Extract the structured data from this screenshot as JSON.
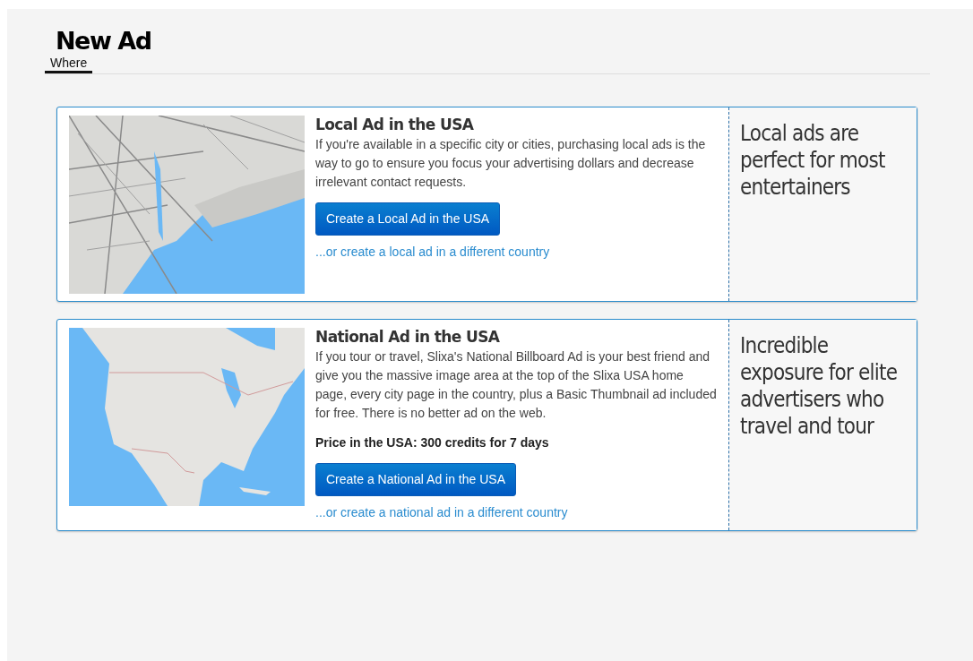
{
  "page": {
    "title": "New Ad"
  },
  "tabs": [
    {
      "label": "Where",
      "selected": true
    }
  ],
  "ads": [
    {
      "title": "Local Ad in the USA",
      "description": "If you're available in a specific city or cities, purchasing local ads is the way to go to ensure you focus your advertising dollars and decrease irrelevant contact requests.",
      "button": "Create a Local Ad in the USA",
      "link": "...or create a local ad in a different country",
      "tagline": "Local ads are perfect for most entertainers"
    },
    {
      "title": "National Ad in the USA",
      "description": "If you tour or travel, Slixa's National Billboard Ad is your best friend and give you the massive image area at the top of the Slixa USA home page, every city page in the country, plus a Basic Thumbnail ad included for free. There is no better ad on the web.",
      "price": "Price in the USA: 300 credits for 7 days",
      "button": "Create a National Ad in the USA",
      "link": "...or create a national ad in a different country",
      "tagline": "Incredible exposure for elite advertisers who travel and tour"
    }
  ]
}
